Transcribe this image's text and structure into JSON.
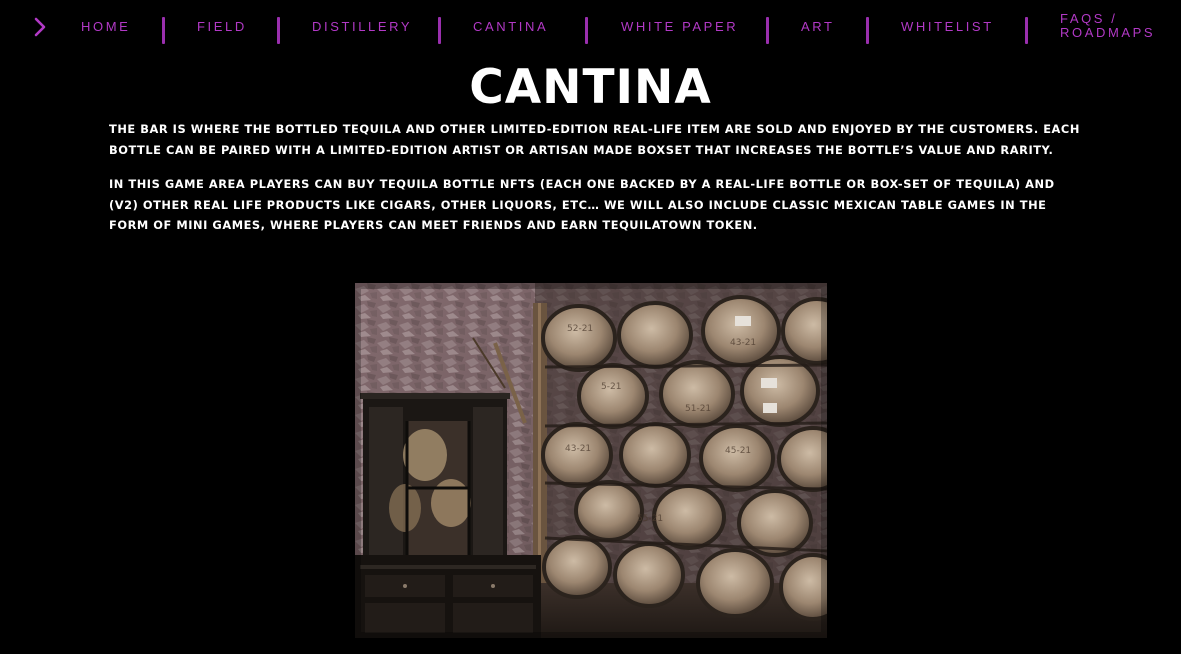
{
  "nav": {
    "items": [
      {
        "label": "HOME"
      },
      {
        "label": "FIELD"
      },
      {
        "label": "DISTILLERY"
      },
      {
        "label": "CANTINA"
      },
      {
        "label": "WHITE PAPER"
      },
      {
        "label": "ART"
      },
      {
        "label": "WHITELIST"
      },
      {
        "label_line1": "FAQS /",
        "label_line2": "ROADMAPS"
      }
    ],
    "arrow_icon": "chevron-right-icon",
    "accent_color": "#b239c6"
  },
  "page": {
    "title": "CANTINA",
    "paragraphs": [
      "The bar is where the bottled tequila and other limited-edition real-life item are sold and enjoyed by the customers. Each bottle can be paired with a limited-edition artist or artisan made boxset that increases the bottle’s value and rarity.",
      "In this game area players can buy tequila bottle NFTs (each one backed by a real-life bottle or box-set of tequila) and (V2) other real life products like cigars, other liquors, etc… We will also include classic Mexican table games in the form of mini games, where players can meet friends and earn tequilatown token."
    ]
  },
  "photo": {
    "subject": "barrel-cellar-photo",
    "barrel_labels": [
      "52-21",
      "43-21",
      "5-21",
      "51-21",
      "43-21",
      "45-21",
      "55-21"
    ]
  },
  "colors": {
    "background": "#000000",
    "text": "#ffffff",
    "accent": "#b239c6"
  }
}
